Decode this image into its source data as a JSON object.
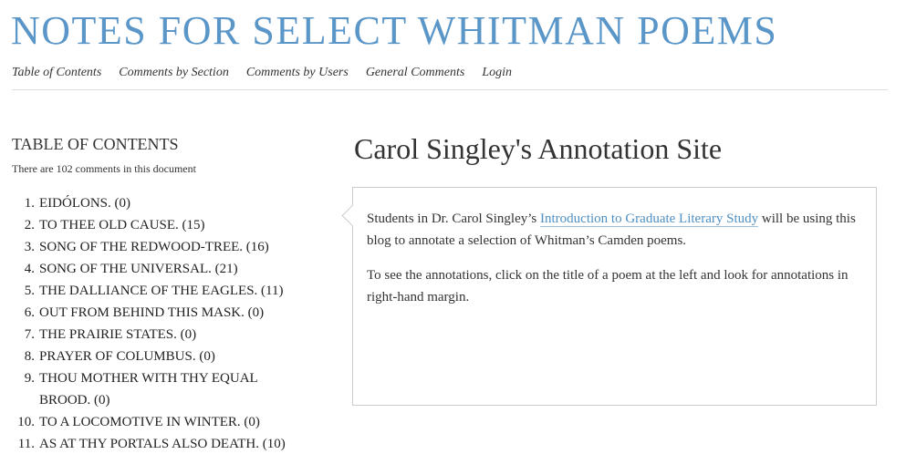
{
  "site": {
    "title": "NOTES FOR SELECT WHITMAN POEMS"
  },
  "nav": [
    {
      "label": "Table of Contents"
    },
    {
      "label": "Comments by Section"
    },
    {
      "label": "Comments by Users"
    },
    {
      "label": "General Comments"
    },
    {
      "label": "Login"
    }
  ],
  "toc": {
    "heading": "TABLE OF CONTENTS",
    "count_text": "There are 102 comments in this document",
    "items": [
      {
        "num": "1.",
        "title": "EIDÓLONS. (0)"
      },
      {
        "num": "2.",
        "title": "TO THEE OLD CAUSE. (15)"
      },
      {
        "num": "3.",
        "title": "SONG OF THE REDWOOD-TREE. (16)"
      },
      {
        "num": "4.",
        "title": "SONG OF THE UNIVERSAL. (21)"
      },
      {
        "num": "5.",
        "title": "THE DALLIANCE OF THE EAGLES. (11)"
      },
      {
        "num": "6.",
        "title": "OUT FROM BEHIND THIS MASK. (0)"
      },
      {
        "num": "7.",
        "title": "THE PRAIRIE STATES. (0)"
      },
      {
        "num": "8.",
        "title": "PRAYER OF COLUMBUS. (0)"
      },
      {
        "num": "9.",
        "title": "THOU MOTHER WITH THY EQUAL BROOD. (0)"
      },
      {
        "num": "10.",
        "title": "TO A LOCOMOTIVE IN WINTER. (0)"
      },
      {
        "num": "11.",
        "title": "AS AT THY PORTALS ALSO DEATH. (10)"
      }
    ]
  },
  "main": {
    "title": "Carol Singley's Annotation Site",
    "para1_before": "Students in Dr. Carol Singley’s ",
    "para1_link": "Introduction to Graduate Literary Study",
    "para1_after": " will be using this blog to annotate a selection of Whitman’s Camden poems.",
    "para2": "To see the annotations, click on the title of a poem at the left and look for annotations in right-hand margin."
  },
  "colors": {
    "title_blue": "#5a96c8",
    "link_blue": "#4f8fc2",
    "border": "#cccccc"
  }
}
